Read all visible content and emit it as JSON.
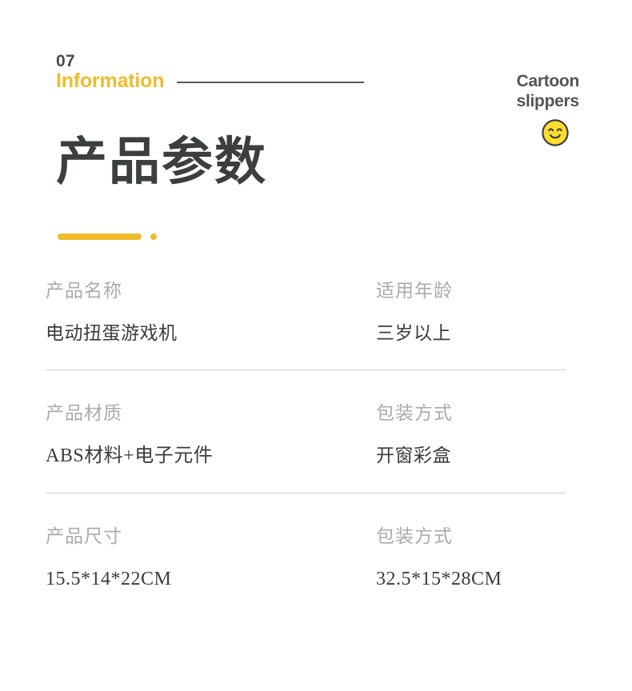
{
  "header": {
    "section_number": "07",
    "section_name": "Information"
  },
  "brand": {
    "line1": "Cartoon",
    "line2": "slippers",
    "emoji_name": "smiling-face-emoji",
    "emoji_color": "#FFDD2E",
    "emoji_outline_color": "#3B403D"
  },
  "title": {
    "main": "产品参数"
  },
  "accent": {
    "color": "#EFBC2C"
  },
  "specs": {
    "rows": [
      {
        "left": {
          "label": "产品名称",
          "value": "电动扭蛋游戏机"
        },
        "right": {
          "label": "适用年龄",
          "value": "三岁以上"
        }
      },
      {
        "left": {
          "label": "产品材质",
          "value": "ABS材料+电子元件"
        },
        "right": {
          "label": "包装方式",
          "value": "开窗彩盒"
        }
      },
      {
        "left": {
          "label": "产品尺寸",
          "value": "15.5*14*22CM"
        },
        "right": {
          "label": "包装方式",
          "value": "32.5*15*28CM"
        }
      }
    ]
  },
  "colors": {
    "accent_yellow": "#EFBC2C",
    "title_dark": "#3B403D",
    "label_gray": "#ABABAB",
    "value_dark": "#3C3C3C",
    "divider_gray": "#D0D0D0"
  }
}
